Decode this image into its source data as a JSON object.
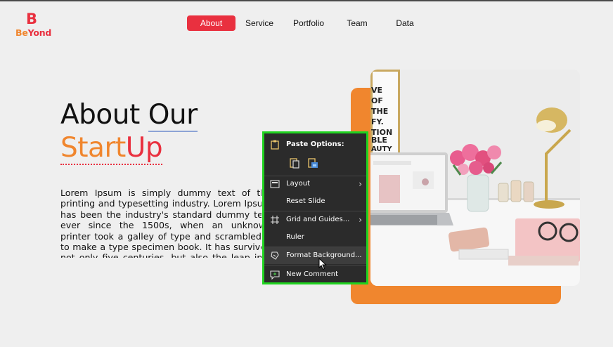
{
  "logo": {
    "mark": "B",
    "text_be": "Be",
    "text_yond": "Yond"
  },
  "nav": {
    "items": [
      {
        "label": "About",
        "active": true
      },
      {
        "label": "Service",
        "active": false
      },
      {
        "label": "Portfolio",
        "active": false
      },
      {
        "label": "Team",
        "active": false
      },
      {
        "label": "Data",
        "active": false
      }
    ]
  },
  "hero": {
    "heading_line1_a": "About ",
    "heading_line1_b": "Our",
    "heading_line2_a": "Start",
    "heading_line2_b": "Up",
    "paragraph": "Lorem Ipsum is simply dummy text of the printing and typesetting industry. Lorem Ipsum has been the industry's standard dummy text ever since the 1500s, when an unknown printer took a galley of type and scrambled it to make a type specimen book. It has survived not only five centuries, but also the leap into electronic"
  },
  "context_menu": {
    "paste_options": "Paste Options:",
    "items": [
      {
        "label": "Layout",
        "submenu": true
      },
      {
        "label": "Reset Slide",
        "submenu": false
      },
      {
        "label": "Grid and Guides...",
        "submenu": true
      },
      {
        "label": "Ruler",
        "submenu": false
      },
      {
        "label": "Format Background...",
        "submenu": false
      },
      {
        "label": "New Comment",
        "submenu": false
      }
    ]
  },
  "poster_text": "VE\nOF\nTHE\nFY.\nTION\nBLE\nAUTY",
  "colors": {
    "accent_red": "#e9303f",
    "accent_orange": "#f0862e",
    "menu_bg": "#2b2b2b",
    "menu_border": "#1fd31f"
  }
}
